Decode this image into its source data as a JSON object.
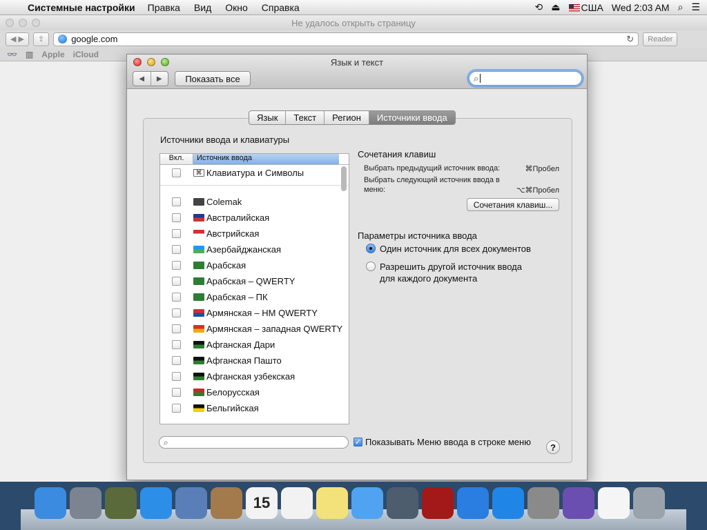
{
  "menubar": {
    "app": "Системные настройки",
    "items": [
      "Правка",
      "Вид",
      "Окно",
      "Справка"
    ],
    "input_source": "США",
    "clock": "Wed 2:03 AM"
  },
  "safari": {
    "title": "Не удалось открыть страницу",
    "url": "google.com",
    "reader": "Reader",
    "bookmarks": [
      "Apple",
      "iCloud"
    ]
  },
  "prefs": {
    "title": "Язык и текст",
    "show_all": "Показать все",
    "search_value": "",
    "tabs": [
      {
        "label": "Язык",
        "selected": false
      },
      {
        "label": "Текст",
        "selected": false
      },
      {
        "label": "Регион",
        "selected": false
      },
      {
        "label": "Источники ввода",
        "selected": true
      }
    ],
    "sources_heading": "Источники ввода и клавиатуры",
    "columns": {
      "on": "Вкл.",
      "source": "Источник ввода"
    },
    "top_item": "Клавиатура и Символы",
    "sources": [
      {
        "label": "Colemak",
        "icon": "colemak-icon",
        "colors": [
          "#444444",
          "#444444"
        ]
      },
      {
        "label": "Австралийская",
        "icon": "australia-flag-icon",
        "colors": [
          "#1f3a8a",
          "#c0392b"
        ]
      },
      {
        "label": "Австрийская",
        "icon": "austria-flag-icon",
        "colors": [
          "#d32f2f",
          "#ffffff"
        ]
      },
      {
        "label": "Азербайджанская",
        "icon": "azerbaijan-flag-icon",
        "colors": [
          "#2196f3",
          "#4caf50"
        ]
      },
      {
        "label": "Арабская",
        "icon": "arabic-crescent-icon",
        "colors": [
          "#2e7d32",
          "#2e7d32"
        ]
      },
      {
        "label": "Арабская – QWERTY",
        "icon": "arabic-crescent-icon",
        "colors": [
          "#2e7d32",
          "#2e7d32"
        ]
      },
      {
        "label": "Арабская – ПК",
        "icon": "arabic-crescent-icon",
        "colors": [
          "#2e7d32",
          "#2e7d32"
        ]
      },
      {
        "label": "Армянская – HM QWERTY",
        "icon": "armenia-flag-icon",
        "colors": [
          "#d32f2f",
          "#1e4fa3"
        ]
      },
      {
        "label": "Армянская – западная QWERTY",
        "icon": "armenia-flag-icon",
        "colors": [
          "#d32f2f",
          "#f2a900"
        ]
      },
      {
        "label": "Афганская Дари",
        "icon": "afghanistan-flag-icon",
        "colors": [
          "#111111",
          "#2e7d32"
        ]
      },
      {
        "label": "Афганская Пашто",
        "icon": "afghanistan-flag-icon",
        "colors": [
          "#111111",
          "#2e7d32"
        ]
      },
      {
        "label": "Афганская узбекская",
        "icon": "afghanistan-flag-icon",
        "colors": [
          "#111111",
          "#2e7d32"
        ]
      },
      {
        "label": "Белорусская",
        "icon": "belarus-flag-icon",
        "colors": [
          "#c62828",
          "#2e7d32"
        ]
      },
      {
        "label": "Бельгийская",
        "icon": "belgium-flag-icon",
        "colors": [
          "#111111",
          "#f4d000"
        ]
      }
    ],
    "shortcuts_heading": "Сочетания клавиш",
    "shortcut_prev": "Выбрать предыдущий источник ввода:",
    "shortcut_prev_key": "⌘Пробел",
    "shortcut_next_1": "Выбрать следующий источник ввода в",
    "shortcut_next_2": "меню:",
    "shortcut_next_key": "⌥⌘Пробел",
    "shortcuts_button": "Сочетания клавиш...",
    "params_heading": "Параметры источника ввода",
    "radio_one": "Один источник для всех документов",
    "radio_two_1": "Разрешить другой источник ввода",
    "radio_two_2": "для каждого документа",
    "show_menu": "Показывать Меню ввода в строке меню",
    "help": "?"
  },
  "dock": {
    "calendar_day": "15",
    "items": [
      {
        "icon": "finder-icon",
        "color": "#3b8be0"
      },
      {
        "icon": "launchpad-icon",
        "color": "#7b8490"
      },
      {
        "icon": "mission-control-icon",
        "color": "#5a6a3a"
      },
      {
        "icon": "safari-icon",
        "color": "#2d8ee8"
      },
      {
        "icon": "mail-icon",
        "color": "#5a7fb8"
      },
      {
        "icon": "contacts-icon",
        "color": "#a37a4c"
      },
      {
        "icon": "calendar-icon",
        "color": "#f3f3f3"
      },
      {
        "icon": "reminders-icon",
        "color": "#f2f2f2"
      },
      {
        "icon": "notes-icon",
        "color": "#f3e27a"
      },
      {
        "icon": "messages-icon",
        "color": "#4fa3f0"
      },
      {
        "icon": "facetime-icon",
        "color": "#4d5d6d"
      },
      {
        "icon": "photo-booth-icon",
        "color": "#a31818"
      },
      {
        "icon": "itunes-icon",
        "color": "#2a7de1"
      },
      {
        "icon": "app-store-icon",
        "color": "#1f86e8"
      },
      {
        "icon": "system-preferences-icon",
        "color": "#8a8a8a"
      },
      {
        "icon": "wizard-icon",
        "color": "#6a4fb0"
      },
      {
        "icon": "document-icon",
        "color": "#f5f5f5"
      },
      {
        "icon": "trash-icon",
        "color": "#9aa3ab"
      }
    ]
  }
}
